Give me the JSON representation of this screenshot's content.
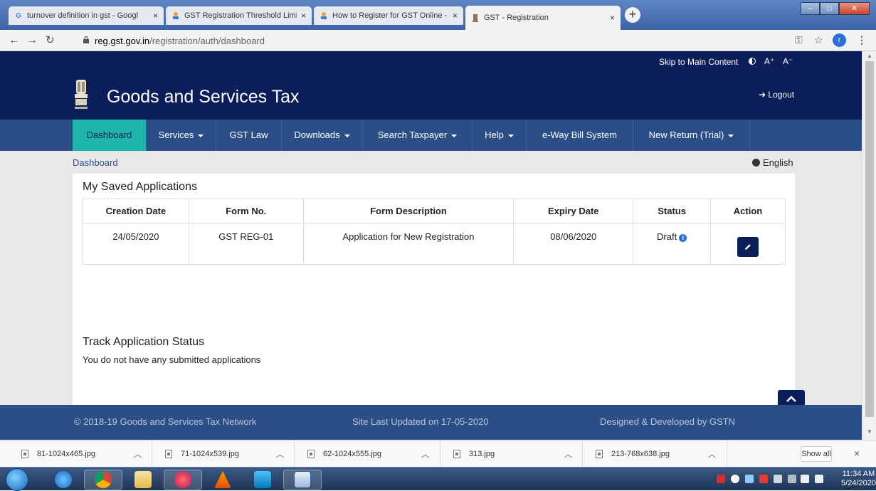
{
  "browser": {
    "tabs": [
      {
        "title": "turnover definition in gst - Googl",
        "icon": "google-icon",
        "active": false
      },
      {
        "title": "GST Registration Threshold Limit",
        "icon": "tab-site-icon",
        "active": false
      },
      {
        "title": "How to Register for GST Online -",
        "icon": "tab-site-icon",
        "active": false
      },
      {
        "title": "GST - Registration",
        "icon": "gst-emblem-icon",
        "active": true
      }
    ],
    "close_glyph": "×",
    "new_tab_glyph": "+",
    "url_host": "reg.gst.gov.in",
    "url_path": "/registration/auth/dashboard",
    "profile_initial": "r"
  },
  "site": {
    "skip_link": "Skip to Main Content",
    "font_increase": "A⁺",
    "font_decrease": "A⁻",
    "title": "Goods and Services Tax",
    "logout": "Logout",
    "nav": [
      {
        "label": "Dashboard",
        "dropdown": false,
        "active": true
      },
      {
        "label": "Services",
        "dropdown": true,
        "active": false
      },
      {
        "label": "GST Law",
        "dropdown": false,
        "active": false
      },
      {
        "label": "Downloads",
        "dropdown": true,
        "active": false
      },
      {
        "label": "Search Taxpayer",
        "dropdown": true,
        "active": false
      },
      {
        "label": "Help",
        "dropdown": true,
        "active": false
      },
      {
        "label": "e-Way Bill System",
        "dropdown": false,
        "active": false
      },
      {
        "label": "New Return (Trial)",
        "dropdown": true,
        "active": false
      }
    ],
    "breadcrumb": "Dashboard",
    "language": "English"
  },
  "saved_applications": {
    "title": "My Saved Applications",
    "columns": [
      "Creation Date",
      "Form No.",
      "Form Description",
      "Expiry Date",
      "Status",
      "Action"
    ],
    "rows": [
      {
        "creation_date": "24/05/2020",
        "form_no": "GST REG-01",
        "description": "Application for New Registration",
        "expiry_date": "08/06/2020",
        "status": "Draft"
      }
    ]
  },
  "track_status": {
    "title": "Track Application Status",
    "message": "You do not have any submitted applications"
  },
  "footer": {
    "copyright": "© 2018-19 Goods and Services Tax Network",
    "updated": "Site Last Updated on 17-05-2020",
    "credit": "Designed & Developed by GSTN"
  },
  "downloads": {
    "items": [
      "81-1024x465.jpg",
      "71-1024x539.jpg",
      "62-1024x555.jpg",
      "313.jpg",
      "213-768x638.jpg"
    ],
    "show_all": "Show all"
  },
  "taskbar": {
    "time": "11:34 AM",
    "date": "5/24/2020"
  }
}
